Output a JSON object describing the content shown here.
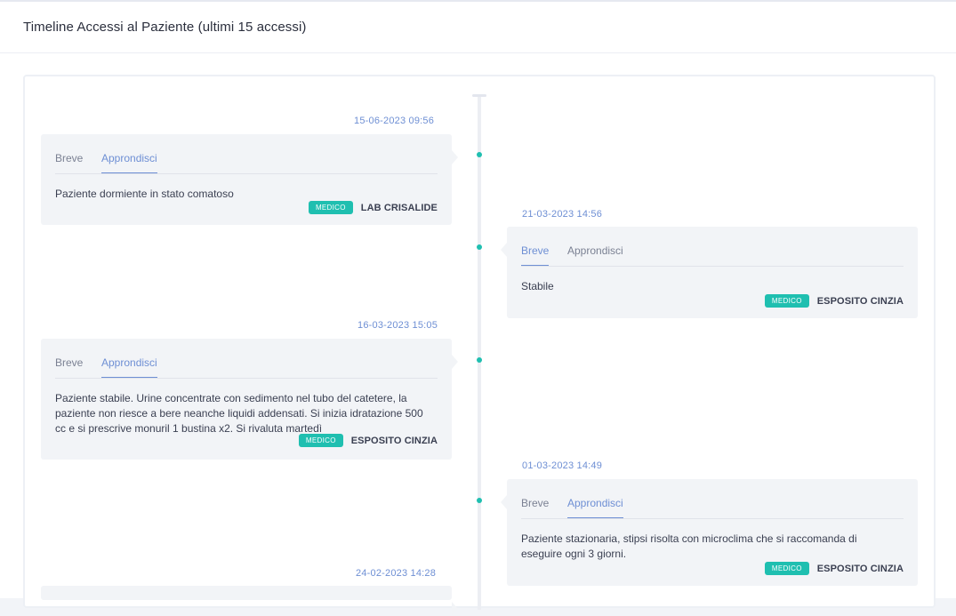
{
  "header": {
    "title": "Timeline Accessi al Paziente (ultimi 15 accessi)"
  },
  "colors": {
    "accent": "#6e8fd4",
    "badge": "#1fbfb0",
    "card_bg": "#f2f4f7"
  },
  "entries": [
    {
      "date": "15-06-2023 09:56",
      "side": "left",
      "tabs": [
        "Breve",
        "Approndisci"
      ],
      "active_tab": "Approndisci",
      "text": "Paziente dormiente in stato comatoso",
      "role": "MEDICO",
      "author": "LAB CRISALIDE"
    },
    {
      "date": "21-03-2023 14:56",
      "side": "right",
      "tabs": [
        "Breve",
        "Approndisci"
      ],
      "active_tab": "Breve",
      "text": "Stabile",
      "role": "MEDICO",
      "author": "ESPOSITO CINZIA"
    },
    {
      "date": "16-03-2023 15:05",
      "side": "left",
      "tabs": [
        "Breve",
        "Approndisci"
      ],
      "active_tab": "Approndisci",
      "text": "Paziente stabile. Urine concentrate con sedimento nel tubo del catetere, la paziente non riesce a bere neanche liquidi addensati. Si inizia idratazione 500 cc e si prescrive monuril 1 bustina x2. Si rivaluta martedì",
      "role": "MEDICO",
      "author": "ESPOSITO CINZIA"
    },
    {
      "date": "01-03-2023 14:49",
      "side": "right",
      "tabs": [
        "Breve",
        "Approndisci"
      ],
      "active_tab": "Approndisci",
      "text": "Paziente stazionaria, stipsi risolta con microclima che si raccomanda di eseguire ogni 3 giorni.",
      "role": "MEDICO",
      "author": "ESPOSITO CINZIA"
    },
    {
      "date": "24-02-2023 14:28",
      "side": "left"
    }
  ]
}
